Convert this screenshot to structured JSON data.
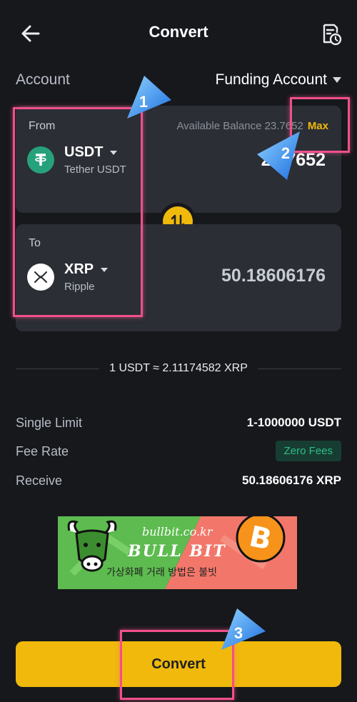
{
  "header": {
    "title": "Convert"
  },
  "account": {
    "label": "Account",
    "selected": "Funding Account"
  },
  "from": {
    "label": "From",
    "available_label": "Available Balance 23.76",
    "available_hidden": "52",
    "max_label": "Max",
    "coin_symbol": "USDT",
    "coin_name": "Tether USDT",
    "amount": "23.7652"
  },
  "to": {
    "label": "To",
    "coin_symbol": "XRP",
    "coin_name": "Ripple",
    "amount": "50.18606176"
  },
  "rate": "1 USDT ≈ 2.11174582 XRP",
  "details": [
    {
      "label": "Single Limit",
      "value": "1-1000000 USDT"
    },
    {
      "label": "Fee Rate",
      "value": "Zero Fees"
    },
    {
      "label": "Receive",
      "value": "50.18606176 XRP"
    }
  ],
  "banner": {
    "url": "bullbit.co.kr",
    "name": "BULL BIT",
    "slogan": "가상화폐 거래 방법은 불빗"
  },
  "convert_button": "Convert",
  "annotations": {
    "step1": "1",
    "step2": "2",
    "step3": "3"
  },
  "colors": {
    "accent": "#f0b90b",
    "usdt": "#26a17b",
    "fee_green": "#2ebd85",
    "highlight": "#f0508a"
  }
}
